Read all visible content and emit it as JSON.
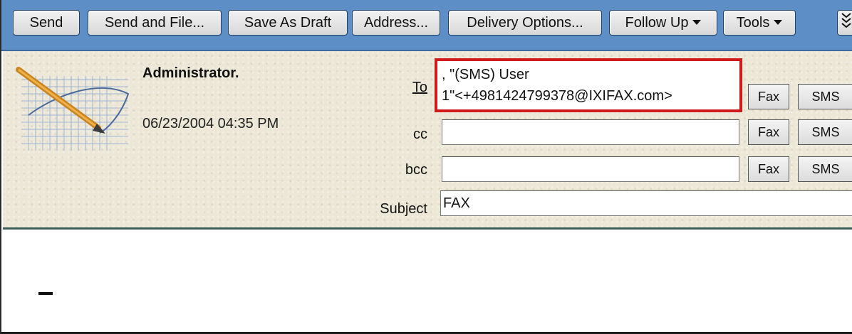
{
  "toolbar": {
    "buttons": [
      {
        "label": "Send"
      },
      {
        "label": "Send and File..."
      },
      {
        "label": "Save As Draft"
      },
      {
        "label": "Address..."
      },
      {
        "label": "Delivery Options..."
      },
      {
        "label": "Follow Up"
      },
      {
        "label": "Tools"
      }
    ],
    "more_icon": "double-chevron-down-icon",
    "color": "#5d8ec6"
  },
  "sender": {
    "name": "Administrator.",
    "datetime": "06/23/2004 04:35 PM",
    "icon": "pencil-notepad-icon"
  },
  "fields": {
    "to_label": "To",
    "to_value_line1": ", \"(SMS) User",
    "to_value_line2": "1\"<+4981424799378@IXIFAX.com>",
    "cc_label": "cc",
    "cc_value": "",
    "bcc_label": "bcc",
    "bcc_value": "",
    "subject_label": "Subject",
    "subject_value": "FAX"
  },
  "side_buttons": {
    "fax": "Fax",
    "sms": "SMS"
  },
  "highlight_color": "#d11a1a"
}
